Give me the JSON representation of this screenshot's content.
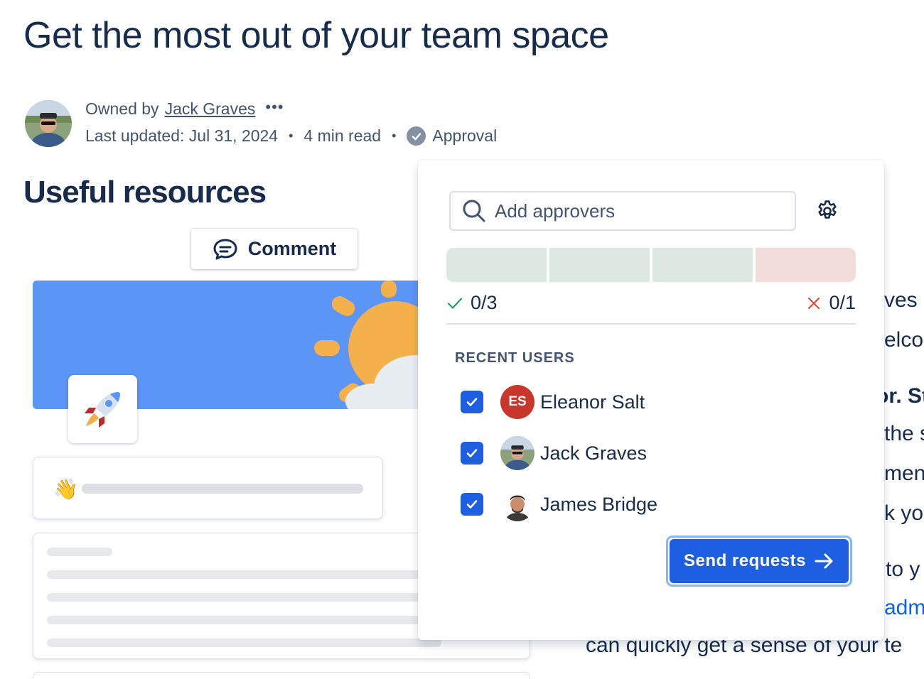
{
  "page": {
    "title": "Get the most out of your team space"
  },
  "byline": {
    "owned_by_label": "Owned by",
    "owner_name": "Jack Graves",
    "more_label": "•••",
    "last_updated": "Last updated: Jul 31, 2024",
    "separator": "•",
    "read_time": "4 min read",
    "approval_label": "Approval"
  },
  "content": {
    "section_title": "Useful resources",
    "comment_label": "Comment",
    "rocket_emoji": "🚀",
    "wave_emoji": "👋",
    "bg_fragments": [
      "ves",
      "elcor",
      "or. St",
      "the s",
      "ment",
      "k yo",
      "to y",
      "adm",
      "can quickly get a sense of your te"
    ]
  },
  "approval_popup": {
    "search_placeholder": "Add approvers",
    "search_value": "",
    "progress": {
      "approved": 0,
      "approvals_needed": 3,
      "rejected": 0,
      "rejections_allowed": 1,
      "approved_text": "0/3",
      "rejected_text": "0/1",
      "approve_color": "#dce8e1",
      "reject_color": "#f2dcdc"
    },
    "recent_heading": "RECENT USERS",
    "users": [
      {
        "name": "Eleanor Salt",
        "initials": "ES",
        "checked": true
      },
      {
        "name": "Jack Graves",
        "initials": "",
        "checked": true
      },
      {
        "name": "James Bridge",
        "initials": "",
        "checked": true
      }
    ],
    "send_label": "Send requests"
  },
  "colors": {
    "primary": "#1d5fe0",
    "text": "#172b4d",
    "subtle_text": "#44546f",
    "success": "#22a06b",
    "danger": "#e2483d",
    "banner": "#5b95f6"
  },
  "icons": [
    "user-photo-icon",
    "more-icon",
    "check-circle-icon",
    "comment-icon",
    "rocket-icon",
    "wave-icon",
    "search-icon",
    "gear-icon",
    "check-icon",
    "close-icon",
    "checkbox-checked-icon",
    "arrow-right-icon"
  ]
}
